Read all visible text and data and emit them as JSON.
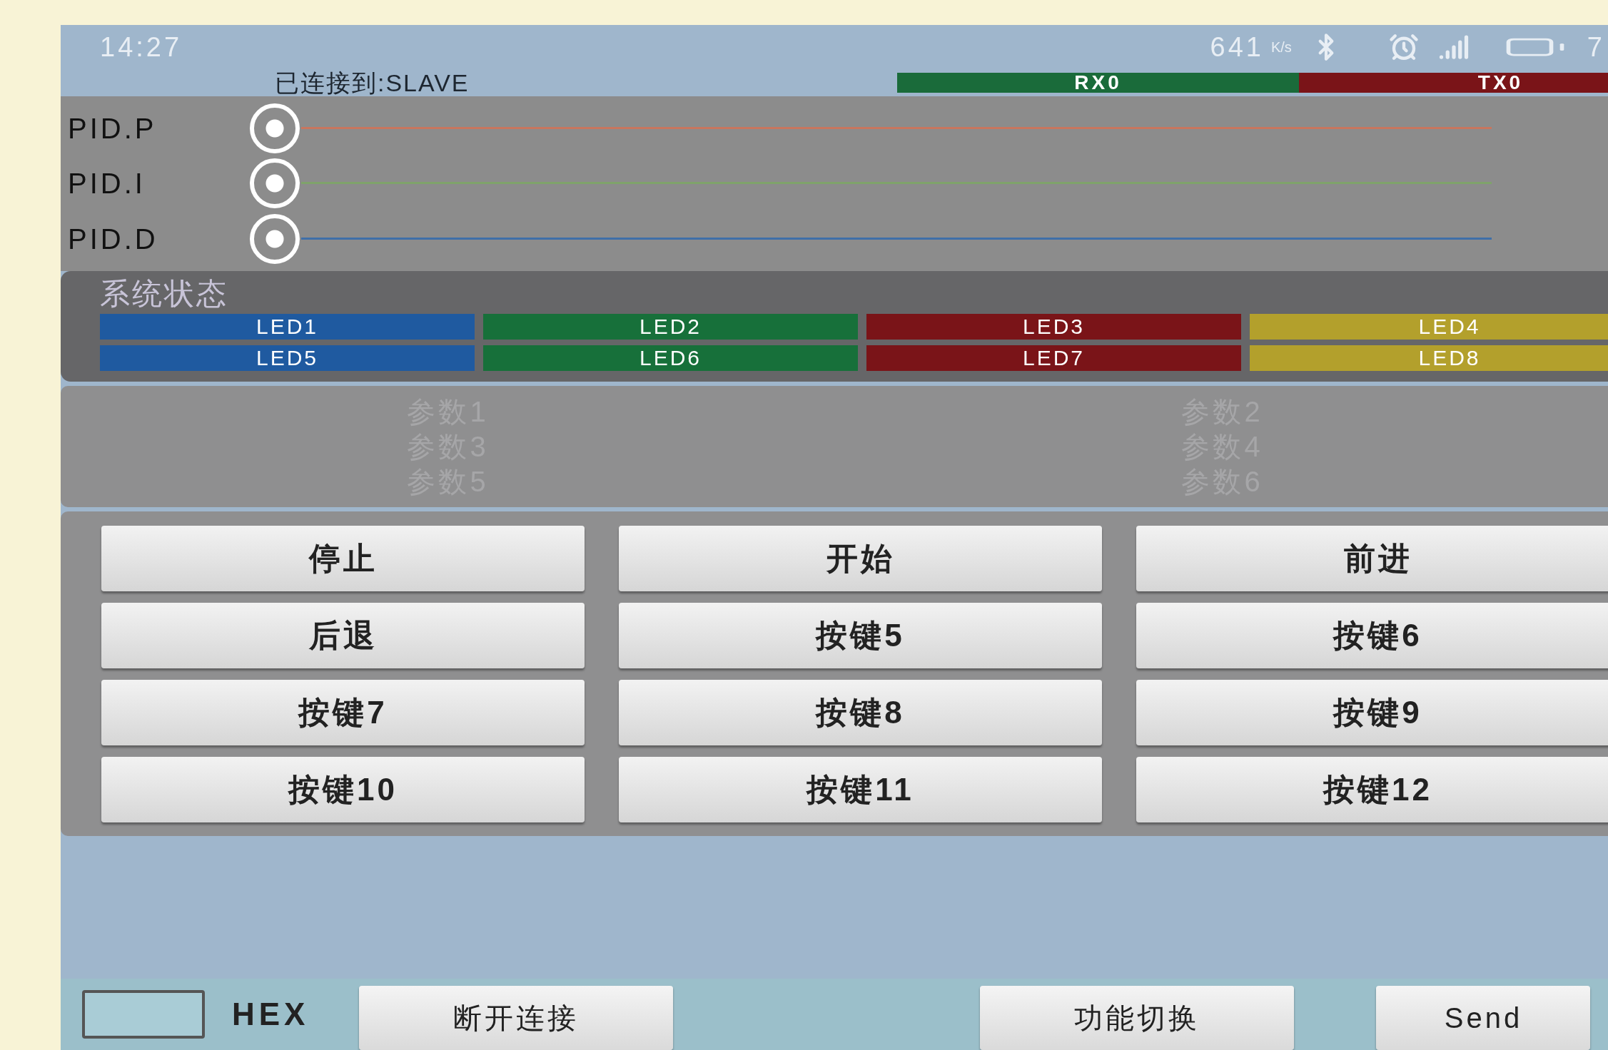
{
  "status_bar": {
    "time": "14:27",
    "speed": "641",
    "speed_unit": "K/s",
    "battery_text": "7"
  },
  "connection": {
    "label": "已连接到:SLAVE",
    "rx": "RX0",
    "tx": "TX0"
  },
  "pid_sliders": [
    {
      "label": "PID.P",
      "level": 0,
      "color": "#c8765e"
    },
    {
      "label": "PID.I",
      "level": 0,
      "color": "#7fa36a"
    },
    {
      "label": "PID.D",
      "level": 0,
      "color": "#3f6fa8"
    }
  ],
  "system_status": {
    "title": "系统状态",
    "leds": [
      {
        "label": "LED1",
        "color": "#1f5aa0"
      },
      {
        "label": "LED2",
        "color": "#17703a"
      },
      {
        "label": "LED3",
        "color": "#7a1418"
      },
      {
        "label": "LED4",
        "color": "#b3a02c"
      },
      {
        "label": "LED5",
        "color": "#1f5aa0"
      },
      {
        "label": "LED6",
        "color": "#17703a"
      },
      {
        "label": "LED7",
        "color": "#7a1418"
      },
      {
        "label": "LED8",
        "color": "#b3a02c"
      }
    ]
  },
  "params": {
    "left": [
      "参数1",
      "参数3",
      "参数5"
    ],
    "right": [
      "参数2",
      "参数4",
      "参数6"
    ]
  },
  "buttons": [
    "停止",
    "开始",
    "前进",
    "后退",
    "按键5",
    "按键6",
    "按键7",
    "按键8",
    "按键9",
    "按键10",
    "按键11",
    "按键12"
  ],
  "bottom": {
    "hex_checked": false,
    "hex_label": "HEX",
    "buttons": [
      "断开连接",
      "功能切换",
      "Send"
    ]
  }
}
